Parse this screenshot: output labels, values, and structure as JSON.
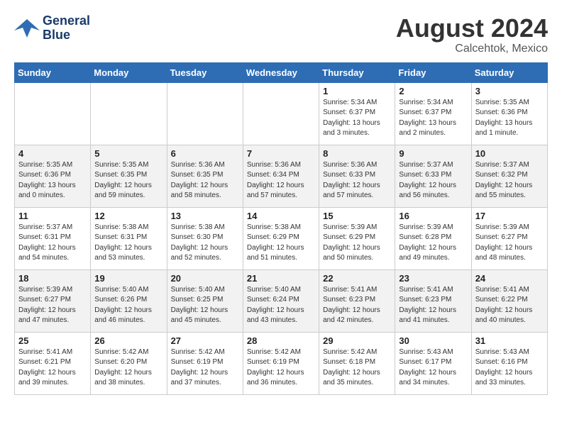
{
  "header": {
    "logo_line1": "General",
    "logo_line2": "Blue",
    "month_year": "August 2024",
    "location": "Calcehtok, Mexico"
  },
  "weekdays": [
    "Sunday",
    "Monday",
    "Tuesday",
    "Wednesday",
    "Thursday",
    "Friday",
    "Saturday"
  ],
  "weeks": [
    [
      {
        "day": "",
        "info": ""
      },
      {
        "day": "",
        "info": ""
      },
      {
        "day": "",
        "info": ""
      },
      {
        "day": "",
        "info": ""
      },
      {
        "day": "1",
        "info": "Sunrise: 5:34 AM\nSunset: 6:37 PM\nDaylight: 13 hours\nand 3 minutes."
      },
      {
        "day": "2",
        "info": "Sunrise: 5:34 AM\nSunset: 6:37 PM\nDaylight: 13 hours\nand 2 minutes."
      },
      {
        "day": "3",
        "info": "Sunrise: 5:35 AM\nSunset: 6:36 PM\nDaylight: 13 hours\nand 1 minute."
      }
    ],
    [
      {
        "day": "4",
        "info": "Sunrise: 5:35 AM\nSunset: 6:36 PM\nDaylight: 13 hours\nand 0 minutes."
      },
      {
        "day": "5",
        "info": "Sunrise: 5:35 AM\nSunset: 6:35 PM\nDaylight: 12 hours\nand 59 minutes."
      },
      {
        "day": "6",
        "info": "Sunrise: 5:36 AM\nSunset: 6:35 PM\nDaylight: 12 hours\nand 58 minutes."
      },
      {
        "day": "7",
        "info": "Sunrise: 5:36 AM\nSunset: 6:34 PM\nDaylight: 12 hours\nand 57 minutes."
      },
      {
        "day": "8",
        "info": "Sunrise: 5:36 AM\nSunset: 6:33 PM\nDaylight: 12 hours\nand 57 minutes."
      },
      {
        "day": "9",
        "info": "Sunrise: 5:37 AM\nSunset: 6:33 PM\nDaylight: 12 hours\nand 56 minutes."
      },
      {
        "day": "10",
        "info": "Sunrise: 5:37 AM\nSunset: 6:32 PM\nDaylight: 12 hours\nand 55 minutes."
      }
    ],
    [
      {
        "day": "11",
        "info": "Sunrise: 5:37 AM\nSunset: 6:31 PM\nDaylight: 12 hours\nand 54 minutes."
      },
      {
        "day": "12",
        "info": "Sunrise: 5:38 AM\nSunset: 6:31 PM\nDaylight: 12 hours\nand 53 minutes."
      },
      {
        "day": "13",
        "info": "Sunrise: 5:38 AM\nSunset: 6:30 PM\nDaylight: 12 hours\nand 52 minutes."
      },
      {
        "day": "14",
        "info": "Sunrise: 5:38 AM\nSunset: 6:29 PM\nDaylight: 12 hours\nand 51 minutes."
      },
      {
        "day": "15",
        "info": "Sunrise: 5:39 AM\nSunset: 6:29 PM\nDaylight: 12 hours\nand 50 minutes."
      },
      {
        "day": "16",
        "info": "Sunrise: 5:39 AM\nSunset: 6:28 PM\nDaylight: 12 hours\nand 49 minutes."
      },
      {
        "day": "17",
        "info": "Sunrise: 5:39 AM\nSunset: 6:27 PM\nDaylight: 12 hours\nand 48 minutes."
      }
    ],
    [
      {
        "day": "18",
        "info": "Sunrise: 5:39 AM\nSunset: 6:27 PM\nDaylight: 12 hours\nand 47 minutes."
      },
      {
        "day": "19",
        "info": "Sunrise: 5:40 AM\nSunset: 6:26 PM\nDaylight: 12 hours\nand 46 minutes."
      },
      {
        "day": "20",
        "info": "Sunrise: 5:40 AM\nSunset: 6:25 PM\nDaylight: 12 hours\nand 45 minutes."
      },
      {
        "day": "21",
        "info": "Sunrise: 5:40 AM\nSunset: 6:24 PM\nDaylight: 12 hours\nand 43 minutes."
      },
      {
        "day": "22",
        "info": "Sunrise: 5:41 AM\nSunset: 6:23 PM\nDaylight: 12 hours\nand 42 minutes."
      },
      {
        "day": "23",
        "info": "Sunrise: 5:41 AM\nSunset: 6:23 PM\nDaylight: 12 hours\nand 41 minutes."
      },
      {
        "day": "24",
        "info": "Sunrise: 5:41 AM\nSunset: 6:22 PM\nDaylight: 12 hours\nand 40 minutes."
      }
    ],
    [
      {
        "day": "25",
        "info": "Sunrise: 5:41 AM\nSunset: 6:21 PM\nDaylight: 12 hours\nand 39 minutes."
      },
      {
        "day": "26",
        "info": "Sunrise: 5:42 AM\nSunset: 6:20 PM\nDaylight: 12 hours\nand 38 minutes."
      },
      {
        "day": "27",
        "info": "Sunrise: 5:42 AM\nSunset: 6:19 PM\nDaylight: 12 hours\nand 37 minutes."
      },
      {
        "day": "28",
        "info": "Sunrise: 5:42 AM\nSunset: 6:19 PM\nDaylight: 12 hours\nand 36 minutes."
      },
      {
        "day": "29",
        "info": "Sunrise: 5:42 AM\nSunset: 6:18 PM\nDaylight: 12 hours\nand 35 minutes."
      },
      {
        "day": "30",
        "info": "Sunrise: 5:43 AM\nSunset: 6:17 PM\nDaylight: 12 hours\nand 34 minutes."
      },
      {
        "day": "31",
        "info": "Sunrise: 5:43 AM\nSunset: 6:16 PM\nDaylight: 12 hours\nand 33 minutes."
      }
    ]
  ]
}
